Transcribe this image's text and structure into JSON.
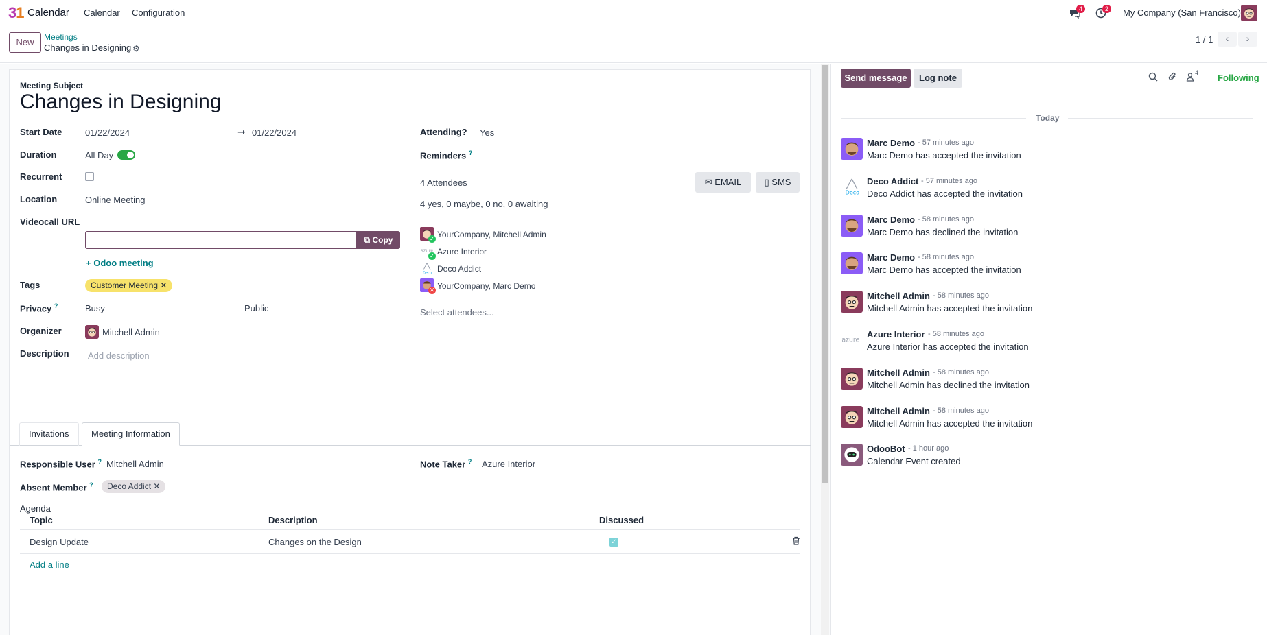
{
  "app": {
    "name": "Calendar",
    "menus": [
      "Calendar",
      "Configuration"
    ],
    "messages_count": "4",
    "activities_count": "2",
    "company": "My Company (San Francisco)"
  },
  "control": {
    "new_label": "New",
    "breadcrumb_parent": "Meetings",
    "breadcrumb_current": "Changes in Designing",
    "pager": "1 / 1"
  },
  "form": {
    "subject_label": "Meeting Subject",
    "subject": "Changes in Designing",
    "start_date_label": "Start Date",
    "start_date": "01/22/2024",
    "end_date": "01/22/2024",
    "duration_label": "Duration",
    "all_day_label": "All Day",
    "all_day": true,
    "recurrent_label": "Recurrent",
    "location_label": "Location",
    "location": "Online Meeting",
    "videocall_label": "Videocall URL",
    "videocall_value": "",
    "copy_label": "Copy",
    "odoo_meeting_label": "Odoo meeting",
    "tags_label": "Tags",
    "tag": "Customer Meeting",
    "privacy_label": "Privacy",
    "show_as": "Busy",
    "privacy": "Public",
    "organizer_label": "Organizer",
    "organizer": "Mitchell Admin",
    "description_label": "Description",
    "description_placeholder": "Add description",
    "attending_label": "Attending?",
    "attending": "Yes",
    "reminders_label": "Reminders",
    "attendees_count": "4 Attendees",
    "email_label": "EMAIL",
    "sms_label": "SMS",
    "attendees_summary": "4 yes, 0 maybe, 0 no, 0 awaiting",
    "attendees": [
      {
        "name": "YourCompany, Mitchell Admin",
        "status": "accepted"
      },
      {
        "name": "Azure Interior",
        "status": "accepted"
      },
      {
        "name": "Deco Addict",
        "status": "none"
      },
      {
        "name": "YourCompany, Marc Demo",
        "status": "declined"
      }
    ],
    "select_attendees": "Select attendees..."
  },
  "tabs": [
    {
      "label": "Invitations",
      "active": false
    },
    {
      "label": "Meeting Information",
      "active": true
    }
  ],
  "meeting_info": {
    "responsible_label": "Responsible User",
    "responsible": "Mitchell Admin",
    "note_taker_label": "Note Taker",
    "note_taker": "Azure Interior",
    "absent_label": "Absent Member",
    "absent": "Deco Addict",
    "agenda_label": "Agenda",
    "columns": [
      "Topic",
      "Description",
      "Discussed"
    ],
    "rows": [
      {
        "topic": "Design Update",
        "description": "Changes on the Design",
        "discussed": true
      }
    ],
    "add_line": "Add a line"
  },
  "chatter": {
    "send_label": "Send message",
    "log_label": "Log note",
    "followers_count": "4",
    "following_label": "Following",
    "today_label": "Today",
    "messages": [
      {
        "author": "Marc Demo",
        "time": "- 57 minutes ago",
        "body": "Marc Demo has accepted the invitation",
        "avatar": "marc"
      },
      {
        "author": "Deco Addict",
        "time": "- 57 minutes ago",
        "body": "Deco Addict has accepted the invitation",
        "avatar": "deco"
      },
      {
        "author": "Marc Demo",
        "time": "- 58 minutes ago",
        "body": "Marc Demo has declined the invitation",
        "avatar": "marc"
      },
      {
        "author": "Marc Demo",
        "time": "- 58 minutes ago",
        "body": "Marc Demo has accepted the invitation",
        "avatar": "marc"
      },
      {
        "author": "Mitchell Admin",
        "time": "- 58 minutes ago",
        "body": "Mitchell Admin has accepted the invitation",
        "avatar": "mitchell"
      },
      {
        "author": "Azure Interior",
        "time": "- 58 minutes ago",
        "body": "Azure Interior has accepted the invitation",
        "avatar": "azure"
      },
      {
        "author": "Mitchell Admin",
        "time": "- 58 minutes ago",
        "body": "Mitchell Admin has declined the invitation",
        "avatar": "mitchell"
      },
      {
        "author": "Mitchell Admin",
        "time": "- 58 minutes ago",
        "body": "Mitchell Admin has accepted the invitation",
        "avatar": "mitchell"
      },
      {
        "author": "OdooBot",
        "time": "- 1 hour ago",
        "body": "Calendar Event created",
        "avatar": "bot"
      }
    ]
  },
  "colors": {
    "brand": "#714b67",
    "link": "#017e84",
    "success": "#28a745",
    "badge": "#e11d48"
  }
}
